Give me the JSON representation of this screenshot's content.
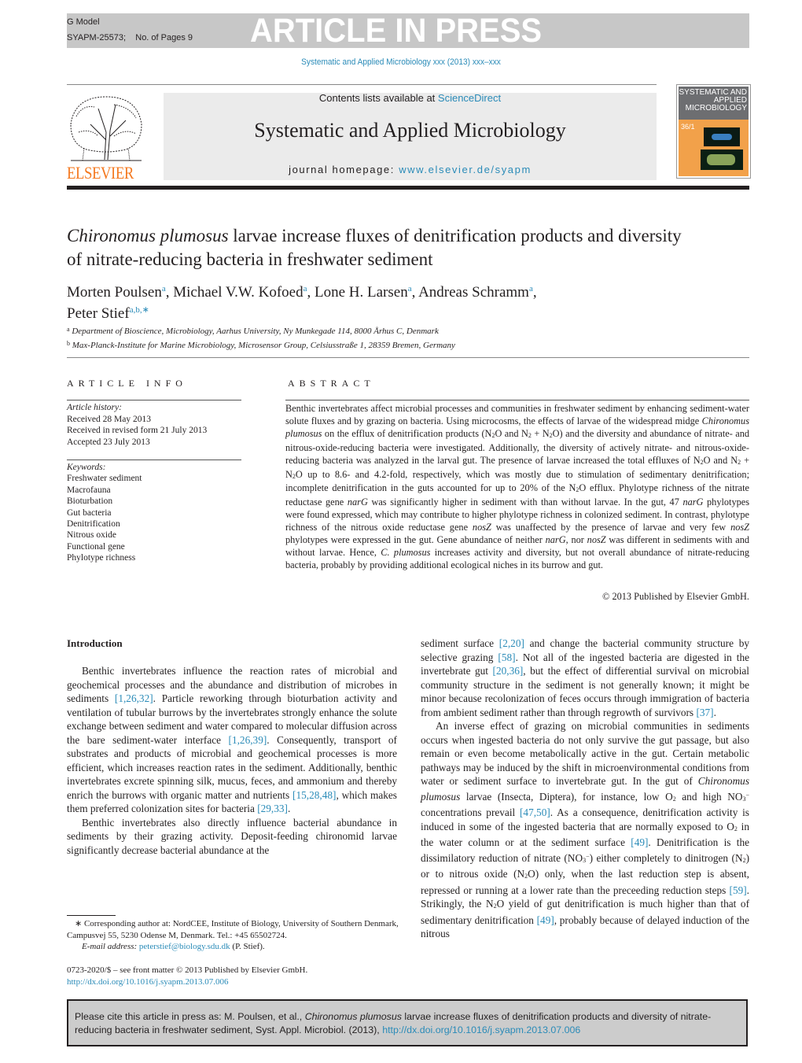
{
  "header": {
    "gmodel": "G Model",
    "article_id": "SYAPM-25573;",
    "pages": "No. of Pages 9",
    "banner": "ARTICLE IN PRESS",
    "journal_ref": "Systematic and Applied Microbiology xxx (2013) xxx–xxx"
  },
  "masthead": {
    "publisher": "ELSEVIER",
    "contents_prefix": "Contents lists available at ",
    "contents_link": "ScienceDirect",
    "journal_name": "Systematic and Applied Microbiology",
    "homepage_prefix": "journal homepage: ",
    "homepage_link": "www.elsevier.de/syapm",
    "cover_title": "SYSTEMATIC AND APPLIED MICROBIOLOGY",
    "cover_volume": "36/1"
  },
  "article": {
    "title_italic": "Chironomus plumosus",
    "title_rest": " larvae increase fluxes of denitrification products and diversity of nitrate-reducing bacteria in freshwater sediment",
    "authors": [
      {
        "name": "Morten Poulsen",
        "sup": "a",
        "sep": ", "
      },
      {
        "name": "Michael V.W. Kofoed",
        "sup": "a",
        "sep": ", "
      },
      {
        "name": "Lone H. Larsen",
        "sup": "a",
        "sep": ", "
      },
      {
        "name": "Andreas Schramm",
        "sup": "a",
        "sep": ","
      },
      {
        "name": "Peter Stief",
        "sup": "a,b,∗",
        "sep": ""
      }
    ],
    "affiliations": [
      {
        "mark": "a",
        "text": "Department of Bioscience, Microbiology, Aarhus University, Ny Munkegade 114, 8000 Århus C, Denmark"
      },
      {
        "mark": "b",
        "text": "Max-Planck-Institute for Marine Microbiology, Microsensor Group, Celsiusstraße 1, 28359 Bremen, Germany"
      }
    ]
  },
  "article_info": {
    "heading": "ARTICLE INFO",
    "history_label": "Article history:",
    "history": [
      "Received 28 May 2013",
      "Received in revised form 21 July 2013",
      "Accepted 23 July 2013"
    ],
    "keywords_label": "Keywords:",
    "keywords": [
      "Freshwater sediment",
      "Macrofauna",
      "Bioturbation",
      "Gut bacteria",
      "Denitrification",
      "Nitrous oxide",
      "Functional gene",
      "Phylotype richness"
    ]
  },
  "abstract": {
    "heading": "ABSTRACT",
    "s1": "Benthic invertebrates affect microbial processes and communities in freshwater sediment by enhancing sediment-water solute fluxes and by grazing on bacteria. Using microcosms, the effects of larvae of the widespread midge ",
    "s1_it": "Chironomus plumosus",
    "s2": " on the efflux of denitrification products (N",
    "s3": "O and N",
    "s4": " + N",
    "s5": "O) and the diversity and abundance of nitrate- and nitrous-oxide-reducing bacteria were investigated. Additionally, the diversity of actively nitrate- and nitrous-oxide-reducing bacteria was analyzed in the larval gut. The presence of larvae increased the total effluxes of N",
    "s6": "O and N",
    "s7": " + N",
    "s8": "O up to 8.6- and 4.2-fold, respectively, which was mostly due to stimulation of sedimentary denitrification; incomplete denitrification in the guts accounted for up to 20% of the N",
    "s9": "O efflux. Phylotype richness of the nitrate reductase gene ",
    "narG": "narG",
    "s10": " was significantly higher in sediment with than without larvae. In the gut, 47 ",
    "s11": " phylotypes were found expressed, which may contribute to higher phylotype richness in colonized sediment. In contrast, phylotype richness of the nitrous oxide reductase gene ",
    "nosZ": "nosZ",
    "s12": " was unaffected by the presence of larvae and very few ",
    "s13": " phylotypes were expressed in the gut. Gene abundance of neither ",
    "s14": ", nor ",
    "s15": " was different in sediments with and without larvae. Hence, ",
    "s15_it": "C. plumosus",
    "s16": " increases activity and diversity, but not overall abundance of nitrate-reducing bacteria, probably by providing additional ecological niches in its burrow and gut.",
    "sub2": "2",
    "copyright": "© 2013 Published by Elsevier GmbH."
  },
  "body": {
    "intro_heading": "Introduction",
    "left": {
      "p1a": "Benthic invertebrates influence the reaction rates of microbial and geochemical processes and the abundance and distribution of microbes in sediments ",
      "r1": "[1,26,32]",
      "p1b": ". Particle reworking through bioturbation activity and ventilation of tubular burrows by the invertebrates strongly enhance the solute exchange between sediment and water compared to molecular diffusion across the bare sediment-water interface ",
      "r2": "[1,26,39]",
      "p1c": ". Consequently, transport of substrates and products of microbial and geochemical processes is more efficient, which increases reaction rates in the sediment. Additionally, benthic invertebrates excrete spinning silk, mucus, feces, and ammonium and thereby enrich the burrows with organic matter and nutrients ",
      "r3": "[15,28,48]",
      "p1d": ", which makes them preferred colonization sites for bacteria ",
      "r4": "[29,33]",
      "p1e": ".",
      "p2": "Benthic invertebrates also directly influence bacterial abundance in sediments by their grazing activity. Deposit-feeding chironomid larvae significantly decrease bacterial abundance at the"
    },
    "right": {
      "c1": "sediment surface ",
      "r1": "[2,20]",
      "c2": " and change the bacterial community structure by selective grazing ",
      "r2": "[58]",
      "c3": ". Not all of the ingested bacteria are digested in the invertebrate gut ",
      "r3": "[20,36]",
      "c4": ", but the effect of differential survival on microbial community structure in the sediment is not generally known; it might be minor because recolonization of feces occurs through immigration of bacteria from ambient sediment rather than through regrowth of survivors ",
      "r4": "[37]",
      "c5": ".",
      "p2a": "An inverse effect of grazing on microbial communities in sediments occurs when ingested bacteria do not only survive the gut passage, but also remain or even become metabolically active in the gut. Certain metabolic pathways may be induced by the shift in microenvironmental conditions from water or sediment surface to invertebrate gut. In the gut of ",
      "p2_it": "Chironomus plumosus",
      "p2b": " larvae (Insecta, Diptera), for instance, low O",
      "p2c": " and high NO",
      "p2d": " concentrations prevail ",
      "r5": "[47,50]",
      "p2e": ". As a consequence, denitrification activity is induced in some of the ingested bacteria that are normally exposed to O",
      "p2f": " in the water column or at the sediment surface ",
      "r6": "[49]",
      "p2g": ". Denitrification is the dissimilatory reduction of nitrate (NO",
      "p2h": ") either completely to dinitrogen (N",
      "p2i": ") or to nitrous oxide (N",
      "p2j": "O) only, when the last reduction step is absent, repressed or running at a lower rate than the preceeding reduction steps ",
      "r7": "[59]",
      "p2k": ". Strikingly, the N",
      "p2l": "O yield of gut denitrification is much higher than that of sedimentary denitrification ",
      "r8": "[49]",
      "p2m": ", probably because of delayed induction of the nitrous",
      "sub2": "2",
      "sub3": "3",
      "supminus": "−"
    }
  },
  "footnotes": {
    "corr": "∗ Corresponding author at: NordCEE, Institute of Biology, University of Southern Denmark, Campusvej 55, 5230 Odense M, Denmark. Tel.: +45 65502724.",
    "email_label": "E-mail address: ",
    "email": "peterstief@biology.sdu.dk",
    "email_suffix": " (P. Stief).",
    "frontmatter": "0723-2020/$ – see front matter © 2013 Published by Elsevier GmbH.",
    "doi": "http://dx.doi.org/10.1016/j.syapm.2013.07.006"
  },
  "citation": {
    "prefix": "Please cite this article in press as: M. Poulsen, et al., ",
    "italic": "Chironomus plumosus",
    "rest": " larvae increase fluxes of denitrification products and diversity of nitrate-reducing bacteria in freshwater sediment, Syst. Appl. Microbiol. (2013), ",
    "doi": "http://dx.doi.org/10.1016/j.syapm.2013.07.006"
  }
}
